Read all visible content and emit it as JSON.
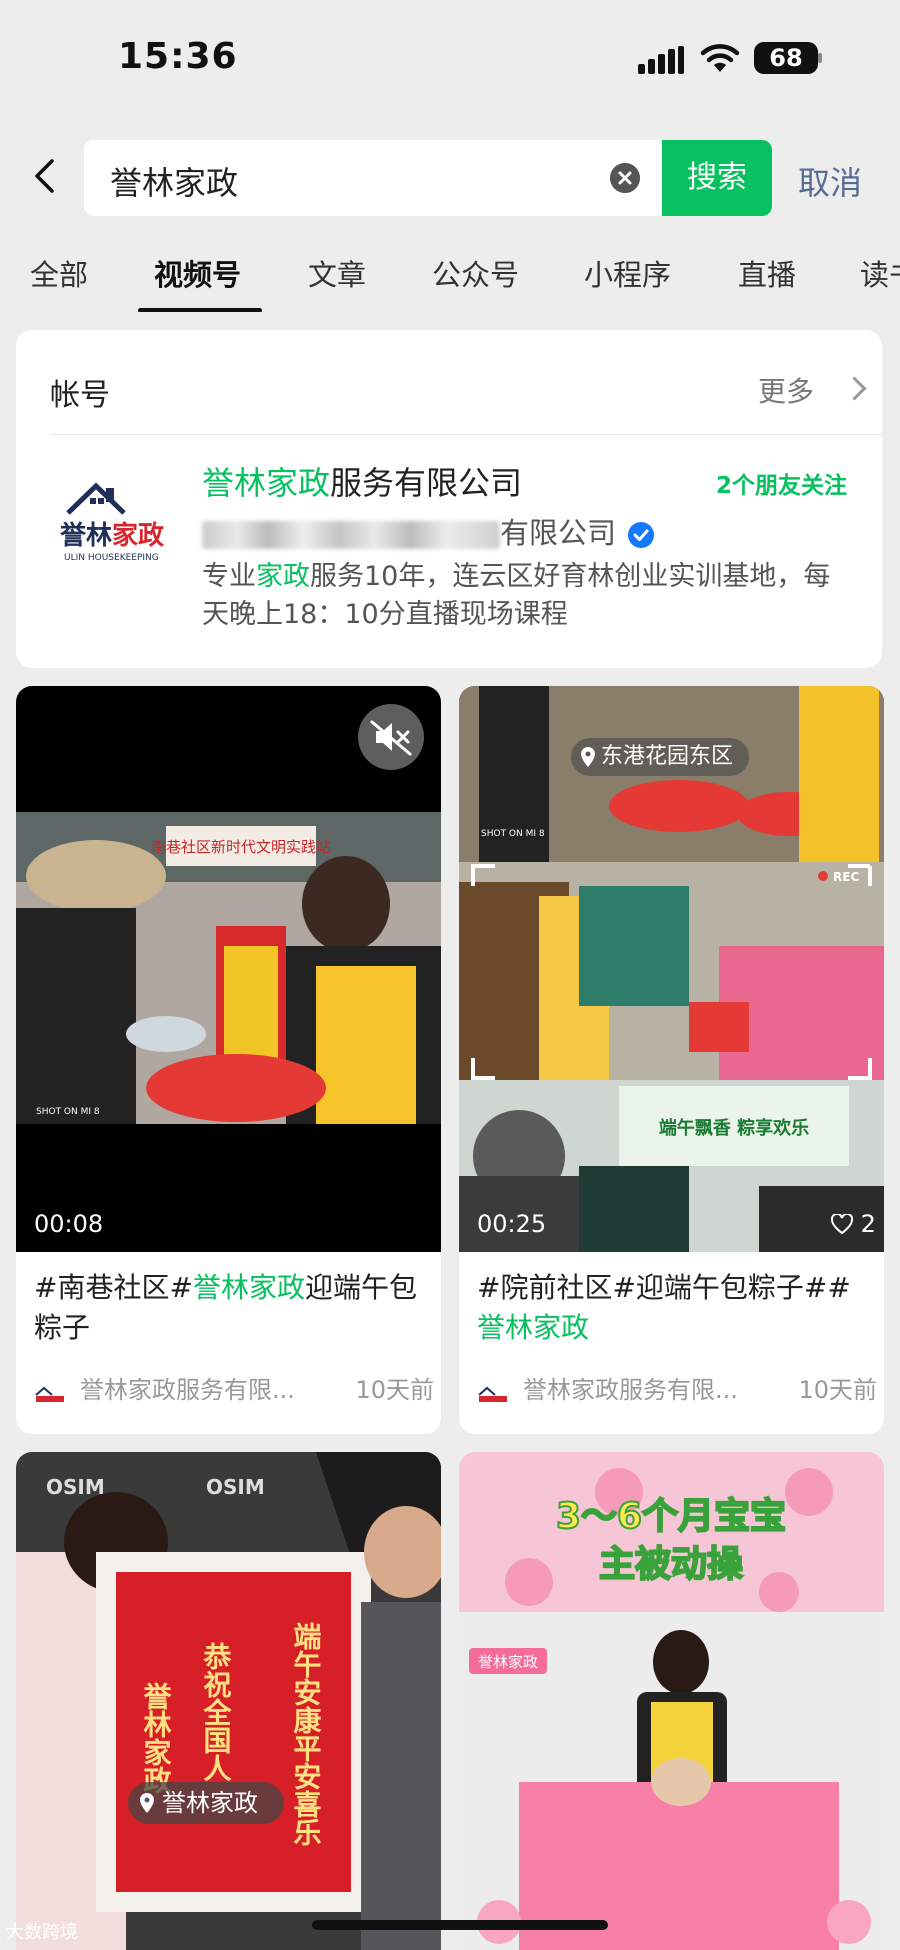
{
  "status": {
    "time": "15:36",
    "battery": "68"
  },
  "search": {
    "query": "誉林家政",
    "button": "搜索",
    "cancel": "取消"
  },
  "tabs": [
    "全部",
    "视频号",
    "文章",
    "公众号",
    "小程序",
    "直播",
    "读书"
  ],
  "account": {
    "heading": "帐号",
    "more": "更多",
    "name_hl": "誉林家政",
    "name_rest": "服务有限公司",
    "friends": "2个朋友关注",
    "sub_suffix": "有限公司",
    "desc_pre": "专业",
    "desc_hl": "家政",
    "desc_post": "服务10年，连云区好育林创业实训基地，每天晚上18：10分直播现场课程",
    "logo_name": "誉林家政",
    "logo_en": "ULIN HOUSEKEEPING"
  },
  "videos": [
    {
      "title_pre": "#南巷社区#",
      "title_hl": "誉林家政",
      "title_post": "迎端午包粽子",
      "author": "誉林家政服务有限...",
      "ago": "10天前",
      "duration": "00:08",
      "camera": "SHOT ON MI 8",
      "banner": "南巷社区新时代文明实践站"
    },
    {
      "title_pre": "#院前社区#迎端午包粽子##",
      "title_hl": "誉林家政",
      "title_post": "",
      "author": "誉林家政服务有限...",
      "ago": "10天前",
      "duration": "00:25",
      "likes": "2",
      "location": "东港花园东区",
      "rec": "REC",
      "poster": "端午飘香 粽享欢乐",
      "camera": "SHOT ON MI 8"
    },
    {
      "location": "誉林家政",
      "brand": "OSIM",
      "scroll_left": "恭祝全国人",
      "scroll_right": "端午安康平安喜乐",
      "scroll_mid": "誉林家政"
    },
    {
      "headline_1": "3～6个月宝宝",
      "headline_2": "主被动操",
      "tag": "誉林家政"
    }
  ],
  "watermark": "大数跨境"
}
